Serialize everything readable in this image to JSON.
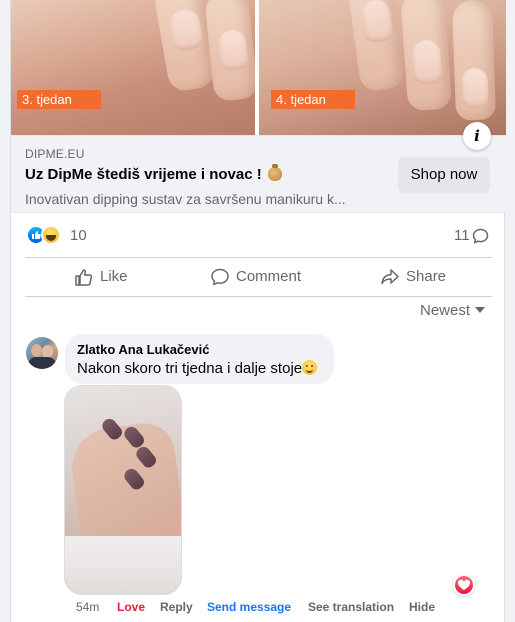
{
  "carousel": {
    "slides": [
      {
        "label": "3. tjedan"
      },
      {
        "label": "4. tjedan"
      }
    ],
    "info_icon": "info-icon"
  },
  "link_preview": {
    "domain": "DIPME.EU",
    "title": "Uz DipMe štediš vrijeme i novac !",
    "title_emoji": "money-bag-icon",
    "description": "Inovativan dipping sustav za savršenu manikuru k...",
    "cta_label": "Shop now"
  },
  "reactions": {
    "icons": [
      "like-reaction-icon",
      "haha-reaction-icon"
    ],
    "count": "10",
    "comment_count": "11",
    "comment_icon": "comment-bubble-icon"
  },
  "actions": {
    "like": "Like",
    "comment": "Comment",
    "share": "Share"
  },
  "comments_sort": {
    "label": "Newest"
  },
  "comment": {
    "author": "Zlatko Ana Lukačević",
    "text": "Nakon skoro tri tjedna i dalje stoje",
    "emoji": "smiling-face-icon",
    "time": "54m",
    "love_label": "Love",
    "reply_label": "Reply",
    "send_message_label": "Send message",
    "see_translation_label": "See translation",
    "hide_label": "Hide",
    "reaction_icon": "love-reaction-icon"
  },
  "colors": {
    "accent_blue": "#1877f2",
    "love_red": "#e41e3f",
    "week_label_orange": "#f26b2f",
    "secondary_text": "#65676b"
  }
}
